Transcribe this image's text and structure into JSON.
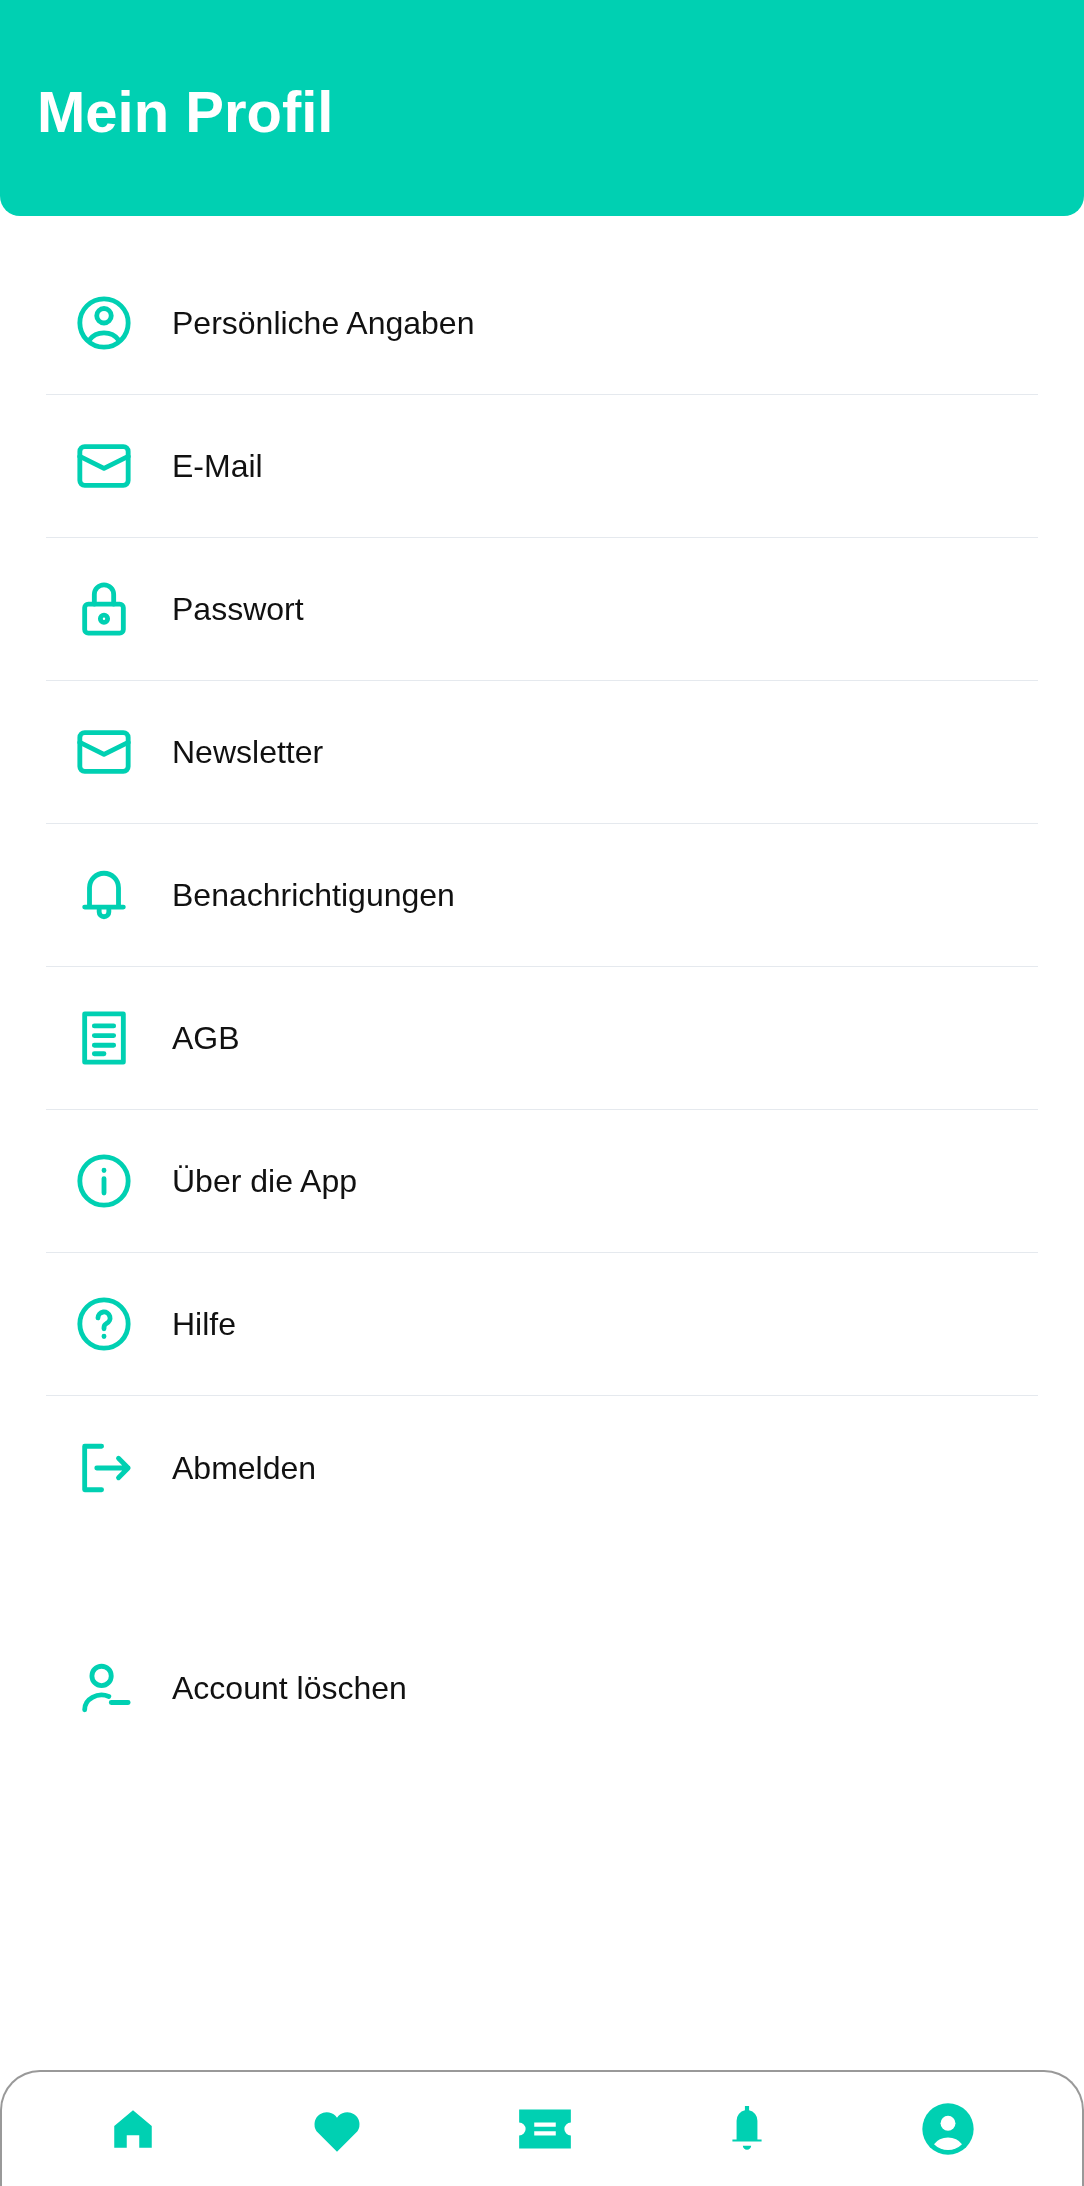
{
  "header": {
    "title": "Mein Profil"
  },
  "menu": [
    {
      "label": "Persönliche Angaben"
    },
    {
      "label": "E-Mail"
    },
    {
      "label": "Passwort"
    },
    {
      "label": "Newsletter"
    },
    {
      "label": "Benachrichtigungen"
    },
    {
      "label": "AGB"
    },
    {
      "label": "Über die App"
    },
    {
      "label": "Hilfe"
    },
    {
      "label": "Abmelden"
    }
  ],
  "account_item": {
    "label": "Account löschen"
  }
}
